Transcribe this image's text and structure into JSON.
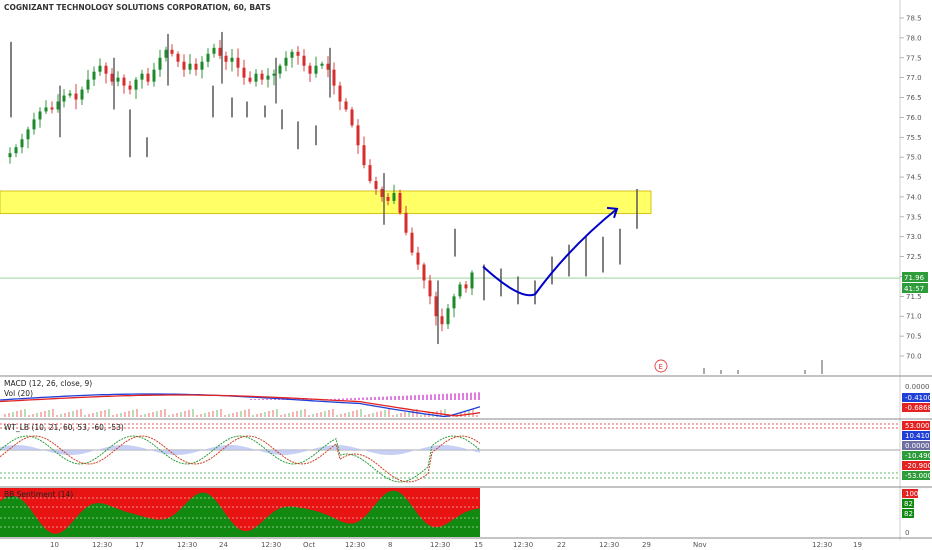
{
  "header": {
    "title": "COGNIZANT TECHNOLOGY SOLUTIONS CORPORATION, 60, BATS"
  },
  "colors": {
    "up": "#1b8a2a",
    "down": "#d62d2d",
    "zone": "#ffff66",
    "zone_border": "#c8b400",
    "projection": "#0000cc",
    "last_price_bg": "#2e9c3a",
    "macd_line": "#1f3fd6",
    "signal_line": "#e32222",
    "histogram": "#e07be0",
    "wt_fill": "#b9c3f2",
    "sentiment_up": "#128a12",
    "sentiment_down": "#e81414"
  },
  "chart_data": [
    {
      "type": "candlestick",
      "title": "COGNIZANT TECHNOLOGY SOLUTIONS CORPORATION, 60, BATS",
      "ylim": [
        69.8,
        78.75
      ],
      "ticks": [
        "70.0",
        "70.5",
        "71.0",
        "71.5",
        "72.0",
        "72.5",
        "73.0",
        "73.5",
        "74.0",
        "74.5",
        "75.0",
        "75.5",
        "76.0",
        "76.5",
        "77.0",
        "77.5",
        "78.0",
        "78.5"
      ],
      "x_labels": [
        "10",
        "12:30",
        "17",
        "12:30",
        "24",
        "12:30",
        "Oct",
        "12:30",
        "8",
        "12:30",
        "15",
        "12:30",
        "22",
        "12:30",
        "29",
        "Nov",
        "12:30",
        "19"
      ],
      "price_path": [
        75.0,
        75.1,
        75.25,
        75.45,
        75.7,
        75.95,
        76.15,
        76.25,
        76.2,
        76.4,
        76.55,
        76.6,
        76.45,
        76.7,
        76.95,
        77.15,
        77.3,
        77.1,
        76.9,
        77.0,
        76.8,
        76.7,
        76.95,
        77.1,
        76.9,
        77.2,
        77.5,
        77.7,
        77.6,
        77.4,
        77.2,
        77.35,
        77.2,
        77.4,
        77.6,
        77.75,
        77.55,
        77.4,
        77.5,
        77.25,
        77.0,
        76.9,
        77.1,
        76.95,
        77.05,
        77.1,
        77.3,
        77.5,
        77.65,
        77.55,
        77.3,
        77.1,
        77.3,
        77.35,
        77.2,
        76.8,
        76.4,
        76.2,
        75.8,
        75.3,
        74.8,
        74.4,
        74.2,
        74.0,
        73.9,
        74.1,
        73.6,
        73.1,
        72.6,
        72.3,
        71.9,
        71.5,
        71.0,
        70.8,
        71.2,
        71.5,
        71.8,
        71.7,
        72.1
      ],
      "projection_x": [
        "15",
        "29"
      ],
      "projection_y": [
        72.25,
        73.7
      ],
      "horizontal_line": 71.96,
      "resistance_zone": [
        73.58,
        74.15
      ],
      "price_labels": [
        "71.96",
        "41:57"
      ]
    },
    {
      "type": "line",
      "name": "MACD (12, 26, close, 9)",
      "sub_label": "Vol (20)",
      "values": [
        "0.0000",
        "-0.4100",
        "-0.6868",
        "-0.4100",
        "-0.6868"
      ],
      "series": [
        {
          "name": "MACD"
        },
        {
          "name": "Signal"
        },
        {
          "name": "Histogram"
        }
      ]
    },
    {
      "type": "line",
      "name": "WT_LB (10, 21, 60, 53, -60, -53)",
      "values": [
        "53.0000",
        "10.4101",
        "0.0000",
        "-10.4906",
        "-20.9008",
        "-53.0000",
        "-60.0000"
      ]
    },
    {
      "type": "area",
      "name": "BB Sentiment (14)",
      "values": [
        "100",
        "82",
        "82",
        "0"
      ]
    }
  ],
  "footer": {
    "marker": "E"
  }
}
